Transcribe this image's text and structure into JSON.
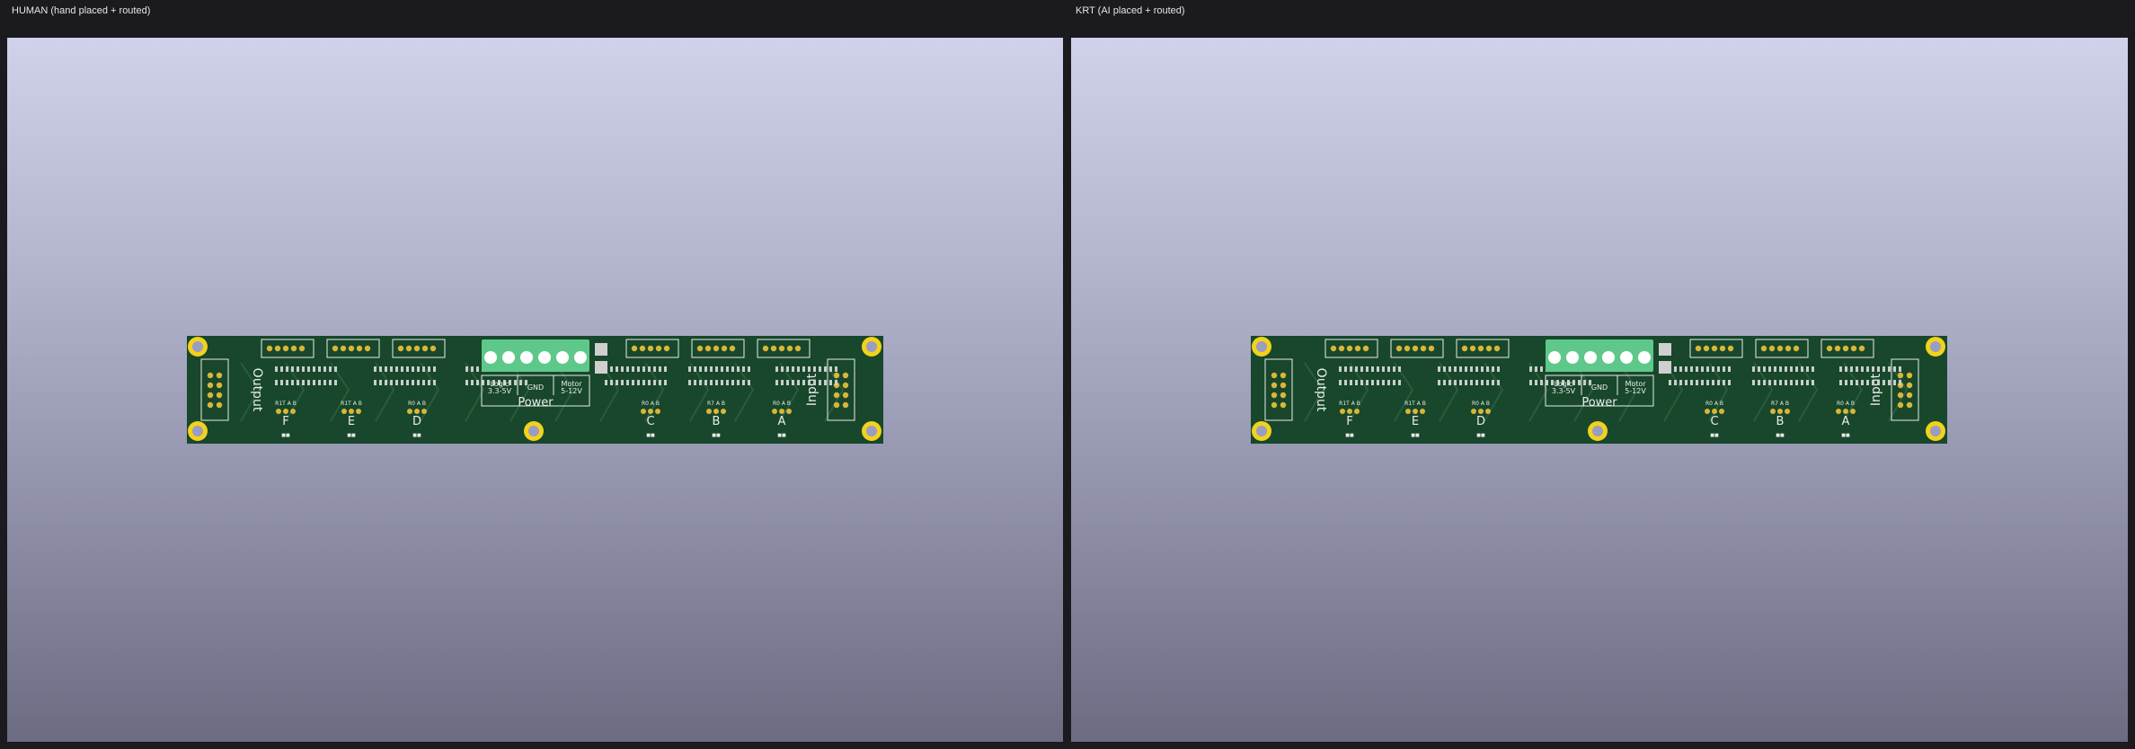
{
  "panes": [
    {
      "title": "HUMAN (hand placed + routed)",
      "board": {
        "output_label": "Output",
        "input_label": "Input",
        "power_label": "Power",
        "terminal_labels": [
          "Logic\n3.3-5V",
          "GND",
          "Motor\n5-12V"
        ],
        "channels": [
          "F",
          "E",
          "D",
          "C",
          "B",
          "A"
        ],
        "jumper_labels": [
          "R1T A B",
          "R1T A B",
          "R0 A B",
          "R0 A B",
          "R7 A B",
          "R0 A B"
        ]
      }
    },
    {
      "title": "KRT (AI placed + routed)",
      "board": {
        "output_label": "Output",
        "input_label": "Input",
        "power_label": "Power",
        "terminal_labels": [
          "Logic\n3.3-5V",
          "GND",
          "Motor\n5-12V"
        ],
        "channels": [
          "F",
          "E",
          "D",
          "C",
          "B",
          "A"
        ],
        "jumper_labels": [
          "R1T A B",
          "R1T A B",
          "R0 A B",
          "R0 A B",
          "R7 A B",
          "R0 A B"
        ]
      }
    }
  ],
  "colors": {
    "pcb": "#18472b",
    "silk": "#e8ecea",
    "pad": "#d9b63a",
    "mount": "#f2d21c",
    "terminal": "#5ec88a"
  }
}
